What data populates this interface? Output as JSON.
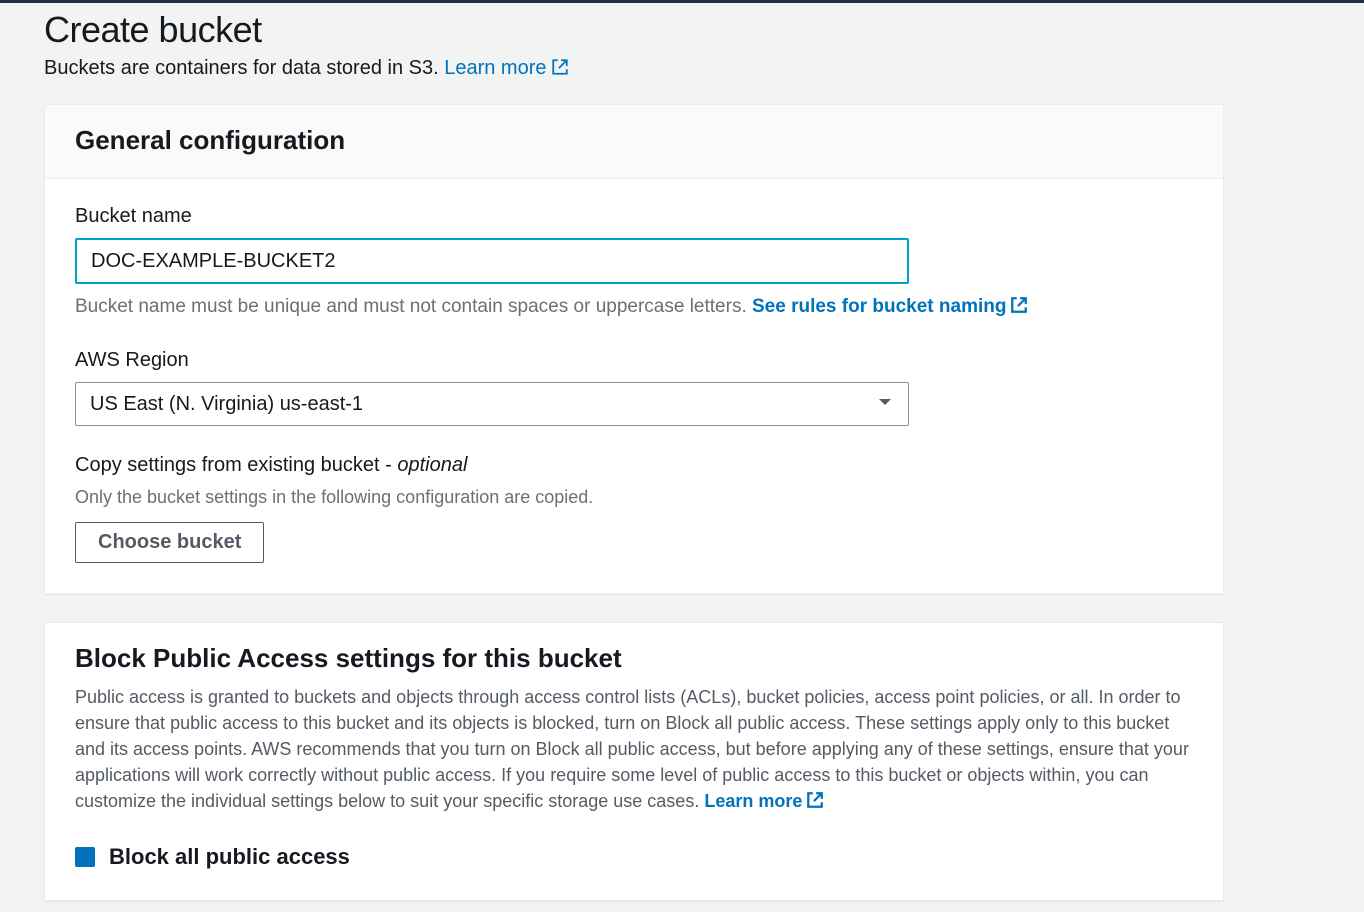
{
  "header": {
    "title": "Create bucket",
    "subtitle_prefix": "Buckets are containers for data stored in S3. ",
    "learn_more": "Learn more"
  },
  "general": {
    "title": "General configuration",
    "bucket_name_label": "Bucket name",
    "bucket_name_value": "DOC-EXAMPLE-BUCKET2",
    "bucket_name_hint_prefix": "Bucket name must be unique and must not contain spaces or uppercase letters. ",
    "bucket_name_rules_link": "See rules for bucket naming",
    "region_label": "AWS Region",
    "region_value": "US East (N. Virginia) us-east-1",
    "copy_label_prefix": "Copy settings from existing bucket - ",
    "copy_label_optional": "optional",
    "copy_hint": "Only the bucket settings in the following configuration are copied.",
    "choose_bucket_button": "Choose bucket"
  },
  "block_public": {
    "title": "Block Public Access settings for this bucket",
    "description_prefix": "Public access is granted to buckets and objects through access control lists (ACLs), bucket policies, access point policies, or all. In order to ensure that public access to this bucket and its objects is blocked, turn on Block all public access. These settings apply only to this bucket and its access points. AWS recommends that you turn on Block all public access, but before applying any of these settings, ensure that your applications will work correctly without public access. If you require some level of public access to this bucket or objects within, you can customize the individual settings below to suit your specific storage use cases. ",
    "learn_more": "Learn more",
    "block_all_label": "Block all public access"
  }
}
